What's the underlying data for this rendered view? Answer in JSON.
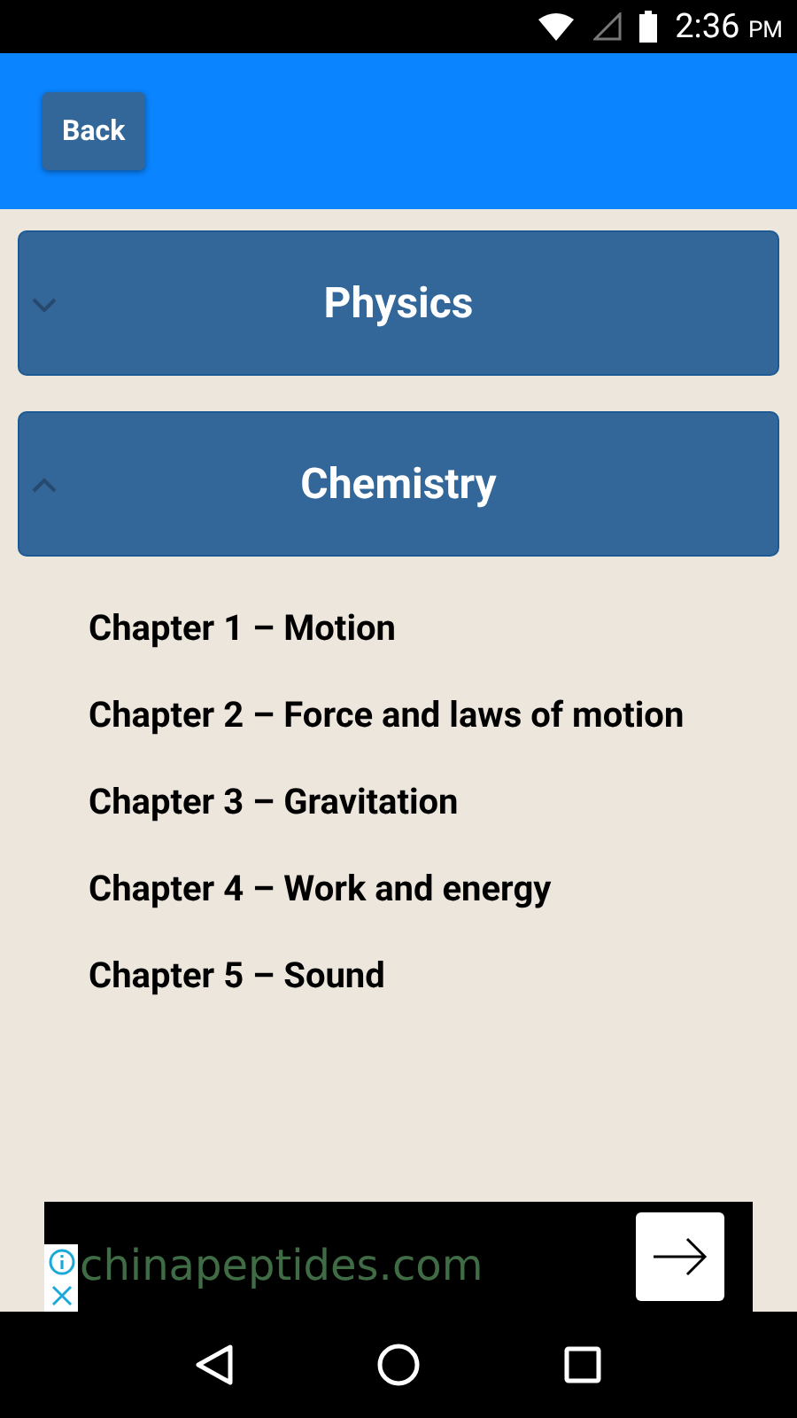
{
  "status_bar": {
    "time": "2:36",
    "meridiem": "PM"
  },
  "header": {
    "back_button": "Back"
  },
  "sections": [
    {
      "title": "Physics",
      "expanded": false
    },
    {
      "title": "Chemistry",
      "expanded": true,
      "chapters": [
        "Chapter 1 – Motion",
        "Chapter 2 – Force and laws of motion",
        "Chapter 3 – Gravitation",
        "Chapter 4 – Work and energy",
        "Chapter 5 – Sound"
      ]
    }
  ],
  "ad": {
    "text": "chinapeptides.com"
  }
}
